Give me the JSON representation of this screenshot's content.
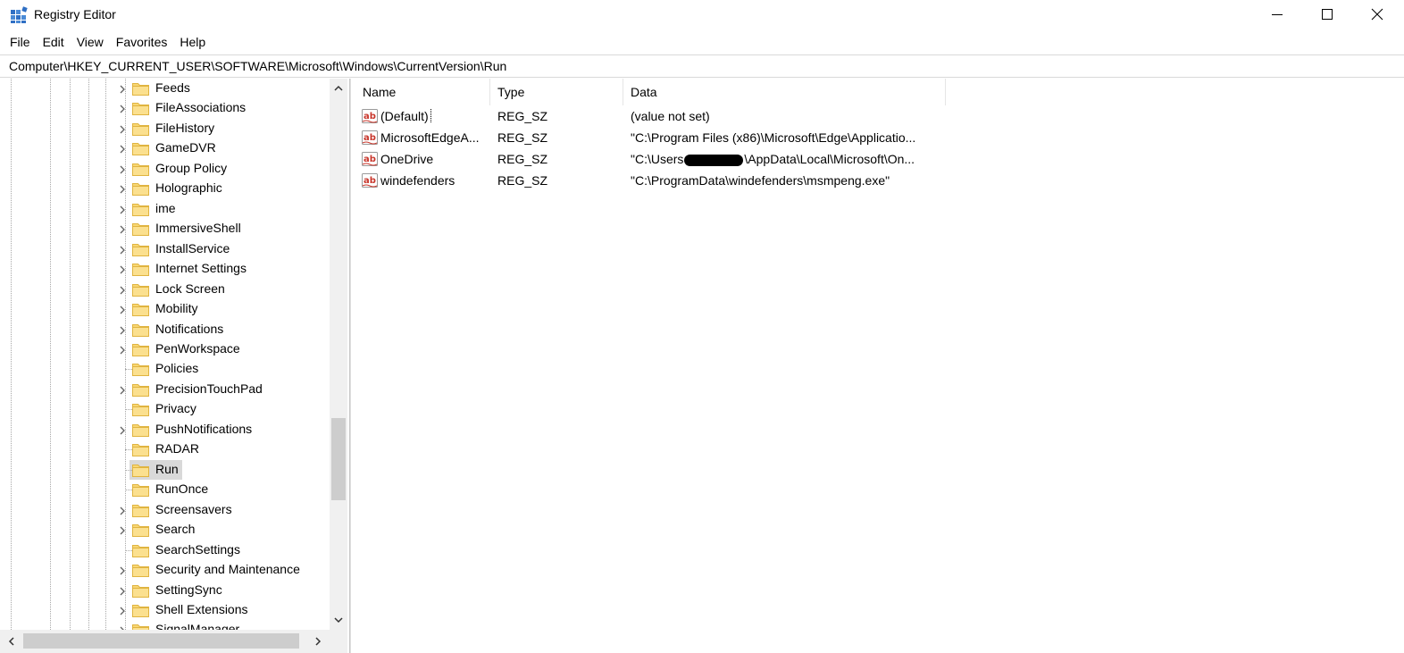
{
  "window": {
    "title": "Registry Editor",
    "controls": {
      "minimize": "minimize-icon",
      "maximize": "maximize-icon",
      "close": "close-icon"
    }
  },
  "menu": [
    "File",
    "Edit",
    "View",
    "Favorites",
    "Help"
  ],
  "address": "Computer\\HKEY_CURRENT_USER\\SOFTWARE\\Microsoft\\Windows\\CurrentVersion\\Run",
  "tree": {
    "selected": "Run",
    "items": [
      {
        "label": "Feeds",
        "expandable": true
      },
      {
        "label": "FileAssociations",
        "expandable": true
      },
      {
        "label": "FileHistory",
        "expandable": true
      },
      {
        "label": "GameDVR",
        "expandable": true
      },
      {
        "label": "Group Policy",
        "expandable": true
      },
      {
        "label": "Holographic",
        "expandable": true
      },
      {
        "label": "ime",
        "expandable": true
      },
      {
        "label": "ImmersiveShell",
        "expandable": true
      },
      {
        "label": "InstallService",
        "expandable": true
      },
      {
        "label": "Internet Settings",
        "expandable": true
      },
      {
        "label": "Lock Screen",
        "expandable": true
      },
      {
        "label": "Mobility",
        "expandable": true
      },
      {
        "label": "Notifications",
        "expandable": true
      },
      {
        "label": "PenWorkspace",
        "expandable": true
      },
      {
        "label": "Policies",
        "expandable": false
      },
      {
        "label": "PrecisionTouchPad",
        "expandable": true
      },
      {
        "label": "Privacy",
        "expandable": false
      },
      {
        "label": "PushNotifications",
        "expandable": true
      },
      {
        "label": "RADAR",
        "expandable": false
      },
      {
        "label": "Run",
        "expandable": false
      },
      {
        "label": "RunOnce",
        "expandable": false
      },
      {
        "label": "Screensavers",
        "expandable": true
      },
      {
        "label": "Search",
        "expandable": true
      },
      {
        "label": "SearchSettings",
        "expandable": false
      },
      {
        "label": "Security and Maintenance",
        "expandable": true
      },
      {
        "label": "SettingSync",
        "expandable": true
      },
      {
        "label": "Shell Extensions",
        "expandable": true
      },
      {
        "label": "SignalManager",
        "expandable": true
      }
    ]
  },
  "values": {
    "columns": [
      "Name",
      "Type",
      "Data"
    ],
    "rows": [
      {
        "name": "(Default)",
        "type": "REG_SZ",
        "data": "(value not set)",
        "icon": "string-value-icon"
      },
      {
        "name": "MicrosoftEdgeA...",
        "type": "REG_SZ",
        "data": "\"C:\\Program Files (x86)\\Microsoft\\Edge\\Applicatio...",
        "icon": "string-value-icon"
      },
      {
        "name": "OneDrive",
        "type": "REG_SZ",
        "data_prefix": "\"C:\\Users",
        "data_suffix": "\\AppData\\Local\\Microsoft\\On...",
        "icon": "string-value-icon"
      },
      {
        "name": "windefenders",
        "type": "REG_SZ",
        "data": "\"C:\\ProgramData\\windefenders\\msmpeng.exe\"",
        "icon": "string-value-icon"
      }
    ]
  },
  "colors": {
    "folder": "#f8d775",
    "folder_edge": "#e0b440",
    "ab_red": "#c8362b",
    "selection": "#d9d9d9"
  }
}
